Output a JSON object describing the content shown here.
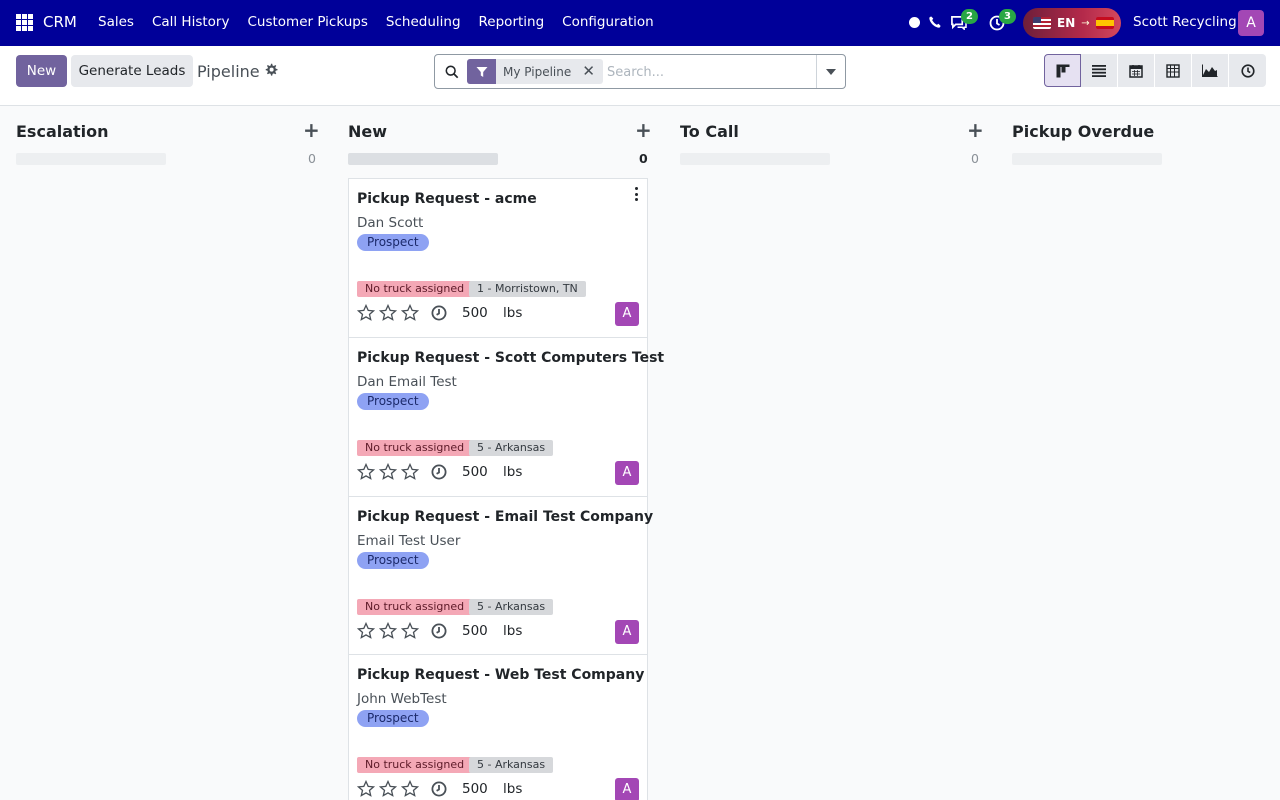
{
  "navbar": {
    "brand": "CRM",
    "menu": [
      "Sales",
      "Call History",
      "Customer Pickups",
      "Scheduling",
      "Reporting",
      "Configuration"
    ],
    "messages_badge": "2",
    "activities_badge": "3",
    "lang_code": "EN",
    "company": "Scott Recycling",
    "avatar_letter": "A",
    "color": "#000099"
  },
  "control_panel": {
    "new_label": "New",
    "generate_label": "Generate Leads",
    "breadcrumb": "Pipeline",
    "facet_label": "My Pipeline",
    "search_placeholder": "Search..."
  },
  "columns": [
    {
      "title": "Escalation",
      "count": "0"
    },
    {
      "title": "New",
      "count": "0"
    },
    {
      "title": "To Call",
      "count": "0"
    },
    {
      "title": "Pickup Overdue"
    }
  ],
  "cards": [
    {
      "title": "Pickup Request - acme",
      "contact": "Dan Scott",
      "tag": "Prospect",
      "truck": "No truck assigned",
      "location": "1 - Morristown, TN",
      "weight": "500",
      "unit": "lbs",
      "avatar": "A"
    },
    {
      "title": "Pickup Request - Scott Computers Test",
      "contact": "Dan Email Test",
      "tag": "Prospect",
      "truck": "No truck assigned",
      "location": "5 - Arkansas",
      "weight": "500",
      "unit": "lbs",
      "avatar": "A"
    },
    {
      "title": "Pickup Request - Email Test Company",
      "contact": "Email Test User",
      "tag": "Prospect",
      "truck": "No truck assigned",
      "location": "5 - Arkansas",
      "weight": "500",
      "unit": "lbs",
      "avatar": "A"
    },
    {
      "title": "Pickup Request - Web Test Company",
      "contact": "John WebTest",
      "tag": "Prospect",
      "truck": "No truck assigned",
      "location": "5 - Arkansas",
      "weight": "500",
      "unit": "lbs",
      "avatar": "A"
    }
  ]
}
